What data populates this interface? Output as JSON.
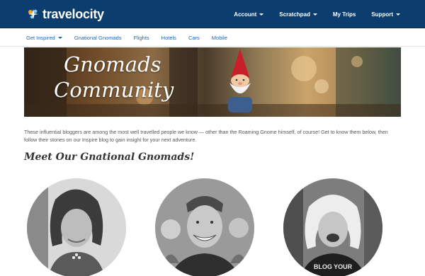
{
  "header": {
    "logo_text": "travelocity",
    "nav": [
      {
        "label": "Account",
        "has_caret": true
      },
      {
        "label": "Scratchpad",
        "has_caret": true
      },
      {
        "label": "My Trips",
        "has_caret": false
      },
      {
        "label": "Support",
        "has_caret": true
      }
    ]
  },
  "subnav": {
    "items": [
      {
        "label": "Get Inspired",
        "has_caret": true
      },
      {
        "label": "Gnational Gnomads",
        "has_caret": false
      },
      {
        "label": "Flights",
        "has_caret": false
      },
      {
        "label": "Hotels",
        "has_caret": false
      },
      {
        "label": "Cars",
        "has_caret": false
      },
      {
        "label": "Mobile",
        "has_caret": false
      }
    ]
  },
  "hero": {
    "title_line1": "Gnomads",
    "title_line2": "Community"
  },
  "intro": "These influential bloggers are among the most well travelled people we know — other than the Roaming Gnome himself, of course! Get to know them below, then follow their stories on our Inspire blog to gain insight for your next adventure.",
  "section_heading": "Meet Our Gnational Gnomads!",
  "bloggers": [
    {
      "photo": "woman-with-curly-hair-portrait"
    },
    {
      "photo": "smiling-man-with-children-portrait"
    },
    {
      "photo": "blonde-woman-laughing-portrait"
    }
  ],
  "blogger3_shirt_text": "BLOG YOUR",
  "colors": {
    "header_bg": "#0b3d6e",
    "link_blue": "#1a66b3",
    "gnome_hat": "#c8202a"
  }
}
